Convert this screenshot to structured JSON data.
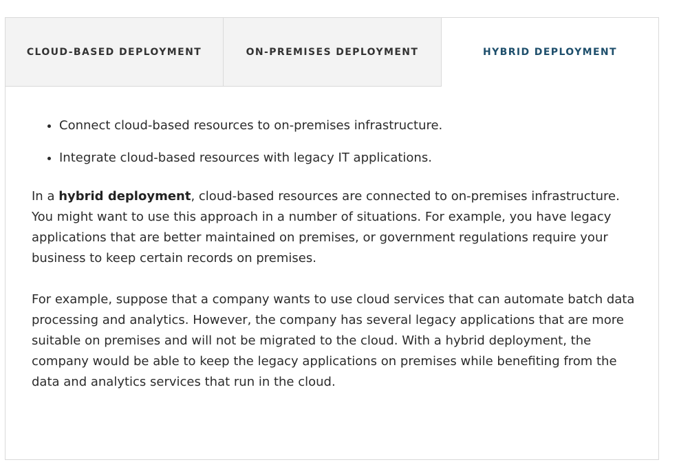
{
  "tabs": [
    {
      "label": "CLOUD-BASED DEPLOYMENT",
      "active": false
    },
    {
      "label": "ON-PREMISES DEPLOYMENT",
      "active": false
    },
    {
      "label": "HYBRID DEPLOYMENT",
      "active": true
    }
  ],
  "content": {
    "bullets": [
      "Connect cloud-based resources to on-premises infrastructure.",
      "Integrate cloud-based resources with legacy IT applications."
    ],
    "paragraph1": {
      "prefix": "In a ",
      "bold": "hybrid deployment",
      "suffix": ", cloud-based resources are connected to on-premises infrastructure. You might want to use this approach in a number of situations. For example, you have legacy applications that are better maintained on premises, or government regulations require your business to keep certain records on premises."
    },
    "paragraph2": "For example, suppose that a company wants to use cloud services that can automate batch data processing and analytics. However, the company has several legacy applications that are more suitable on premises and will not be migrated to the cloud. With a hybrid deployment, the company would be able to keep the legacy applications on premises while benefiting from the data and analytics services that run in the cloud."
  },
  "colors": {
    "active_tab_text": "#1d4e6b",
    "inactive_tab_bg": "#f3f3f3",
    "border": "#d9d9d9",
    "body_text": "#2b2b2b"
  }
}
